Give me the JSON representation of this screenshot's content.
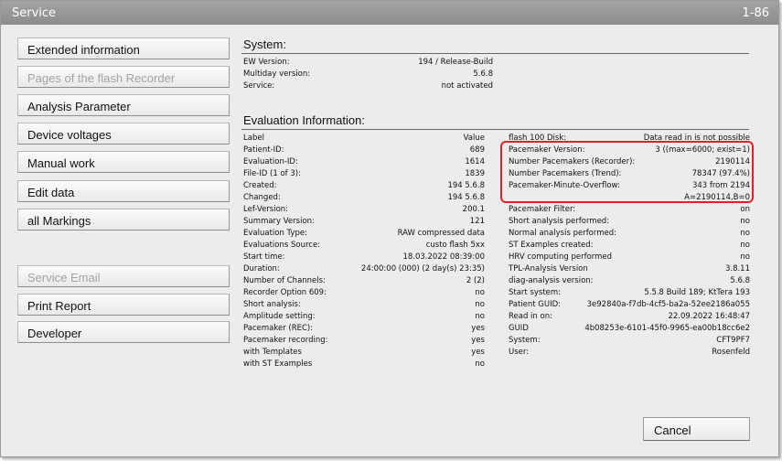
{
  "window": {
    "title": "Service",
    "code": "1-86"
  },
  "buttons": [
    {
      "label": "Extended information",
      "enabled": true
    },
    {
      "label": "Pages of the flash Recorder",
      "enabled": false
    },
    {
      "label": "Analysis Parameter",
      "enabled": true
    },
    {
      "label": "Device voltages",
      "enabled": true
    },
    {
      "label": "Manual work",
      "enabled": true
    },
    {
      "label": "Edit data",
      "enabled": true
    },
    {
      "label": "all Markings",
      "enabled": true
    },
    {
      "label": "Service Email",
      "enabled": false
    },
    {
      "label": "Print Report",
      "enabled": true
    },
    {
      "label": "Developer",
      "enabled": true
    }
  ],
  "system": {
    "title": "System:",
    "rows": [
      {
        "label": "EW Version:",
        "value": "194 / Release-Build"
      },
      {
        "label": "Multiday version:",
        "value": "5.6.8"
      },
      {
        "label": "Service:",
        "value": "not activated"
      }
    ]
  },
  "evaluation": {
    "title": "Evaluation Information:",
    "left_rows": [
      {
        "label": "Label",
        "value": "Value"
      },
      {
        "label": "Patient-ID:",
        "value": "689"
      },
      {
        "label": "Evaluation-ID:",
        "value": "1614"
      },
      {
        "label": "File-ID (1 of 3):",
        "value": "1839"
      },
      {
        "label": "Created:",
        "value": "194 5.6.8"
      },
      {
        "label": "Changed:",
        "value": "194 5.6.8"
      },
      {
        "label": "Lef-Version:",
        "value": "200.1"
      },
      {
        "label": "Summary Version:",
        "value": "121"
      },
      {
        "label": "Evaluation Type:",
        "value": "RAW compressed data"
      },
      {
        "label": "Evaluations Source:",
        "value": "custo flash 5xx"
      },
      {
        "label": "Start time:",
        "value": "18.03.2022 08:39:00"
      },
      {
        "label": "Duration:",
        "value": "24:00:00 (000) (2 day(s) 23:35)"
      },
      {
        "label": "Number of Channels:",
        "value": "2 (2)"
      },
      {
        "label": "Recorder Option 609:",
        "value": "no"
      },
      {
        "label": "Short analysis:",
        "value": "no"
      },
      {
        "label": "Amplitude setting:",
        "value": "no"
      },
      {
        "label": "Pacemaker (REC):",
        "value": "yes"
      },
      {
        "label": "Pacemaker recording:",
        "value": "yes"
      },
      {
        "label": "with Templates",
        "value": "yes"
      },
      {
        "label": "with ST Examples",
        "value": "no"
      }
    ],
    "right_rows": [
      {
        "label": "flash 100 Disk:",
        "value": "Data read in is not possible"
      },
      {
        "label": "Pacemaker Version:",
        "value": "3 ((max=6000; exist=1)"
      },
      {
        "label": "Number Pacemakers (Recorder):",
        "value": "2190114"
      },
      {
        "label": "Number Pacemakers (Trend):",
        "value": "78347 (97.4%)"
      },
      {
        "label": "Pacemaker-Minute-Overflow:",
        "value": "343 from 2194"
      },
      {
        "label": "",
        "value": "A=2190114,B=0"
      },
      {
        "label": "Pacemaker Filter:",
        "value": "on"
      },
      {
        "label": "Short analysis performed:",
        "value": "no"
      },
      {
        "label": "Normal analysis performed:",
        "value": "no"
      },
      {
        "label": "ST Examples created:",
        "value": "no"
      },
      {
        "label": "HRV computing performed",
        "value": "no"
      },
      {
        "label": "TPL-Analysis Version",
        "value": "3.8.11"
      },
      {
        "label": "diag-analysis version:",
        "value": "5.6.8"
      },
      {
        "label": "Start system:",
        "value": "5.5.8 Build 189; KtTera 193"
      },
      {
        "label": "Patient GUID:",
        "value": "3e92840a-f7db-4cf5-ba2a-52ee2186a055"
      },
      {
        "label": "Read in on:",
        "value": "22.09.2022 16:48:47"
      },
      {
        "label": "GUID",
        "value": "4b08253e-6101-45f0-9965-ea00b18cc6e2"
      },
      {
        "label": "System:",
        "value": "CFT9PF7"
      },
      {
        "label": "User:",
        "value": "Rosenfeld"
      }
    ]
  },
  "highlight_color": "#e0202a",
  "cancel_label": "Cancel"
}
